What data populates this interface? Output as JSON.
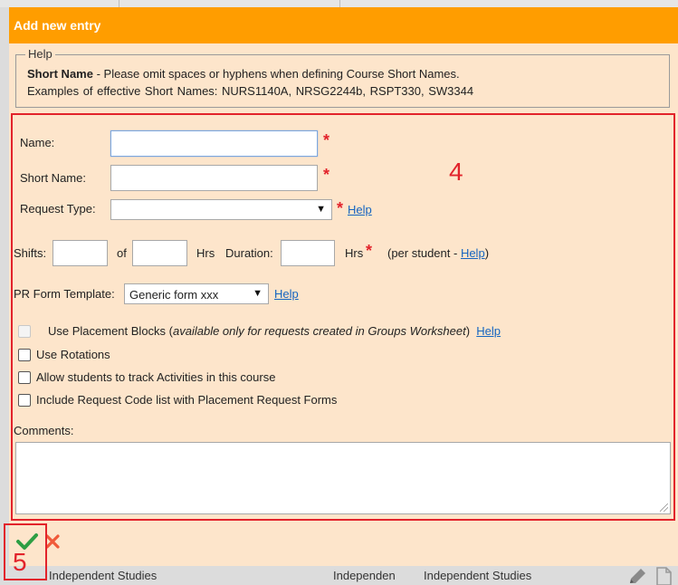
{
  "dialog": {
    "title": "Add new entry"
  },
  "help": {
    "legend": "Help",
    "term": "Short Name",
    "line1_rest": " - Please omit spaces or hyphens when defining Course Short Names.",
    "line2": "Examples of effective Short Names: NURS1140A,  NRSG2244b,  RSPT330,  SW3344"
  },
  "form": {
    "name_label": "Name:",
    "name_value": "",
    "short_name_label": "Short Name:",
    "short_name_value": "",
    "request_type_label": "Request Type:",
    "request_type_value": "",
    "help_link": "Help",
    "shifts_label": "Shifts:",
    "of_label": "of",
    "hrs_label": "Hrs",
    "duration_label": "Duration:",
    "hrs_label2": "Hrs",
    "per_student_prefix": "(per student - ",
    "per_student_suffix": ")",
    "pr_form_label": "PR Form Template:",
    "pr_form_value": "Generic form xxx",
    "placement_blocks_label": "Use Placement Blocks (",
    "placement_blocks_note": "available only for requests created in Groups Worksheet",
    "placement_blocks_close": ")",
    "use_rotations_label": "Use Rotations",
    "allow_students_label": "Allow students to track Activities in this course",
    "include_request_label": "Include Request Code list with Placement Request Forms",
    "comments_label": "Comments:",
    "comments_value": "",
    "required_mark": "*"
  },
  "annotations": {
    "box4_number": "4",
    "box5_number": "5"
  },
  "background_row": {
    "col1": "Independent Studies",
    "col2": "Independen",
    "col3": "Independent Studies"
  },
  "colors": {
    "title_bar": "#ff9d00",
    "dialog_bg": "#fde5cb",
    "annotation_red": "#e2232b",
    "link_blue": "#1565c0",
    "confirm_green": "#2e9e44",
    "cancel_red": "#f05a3a"
  },
  "icons": {
    "confirm": "check-icon",
    "cancel": "close-icon",
    "edit": "edit-icon",
    "document": "doc-icon"
  }
}
